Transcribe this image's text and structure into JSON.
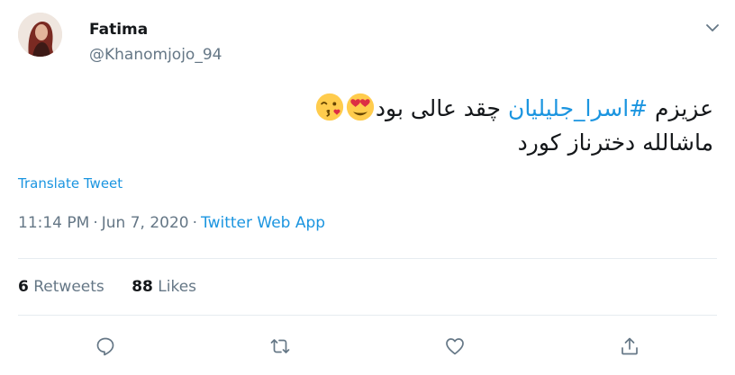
{
  "author": {
    "name": "Fatima",
    "handle": "@Khanomjojo_94"
  },
  "tweet": {
    "line1_before": "عزیزم ",
    "hashtag": "#اسرا_جلیلیان",
    "line1_after": " چقد عالی بود",
    "line2": "ماشالله دخترناز کورد",
    "emojis": [
      "heart-eyes-emoji",
      "kissing-heart-emoji"
    ]
  },
  "translate_label": "Translate Tweet",
  "meta": {
    "time": "11:14 PM",
    "separator": "·",
    "date": "Jun 7, 2020",
    "source": "Twitter Web App"
  },
  "stats": {
    "retweets_count": "6",
    "retweets_label": "Retweets",
    "likes_count": "88",
    "likes_label": "Likes"
  },
  "actions": [
    "reply-icon",
    "retweet-icon",
    "like-icon",
    "share-icon"
  ],
  "colors": {
    "link": "#1b95e0",
    "secondary": "#657786",
    "primary": "#14171a",
    "border": "#e6ecf0"
  }
}
